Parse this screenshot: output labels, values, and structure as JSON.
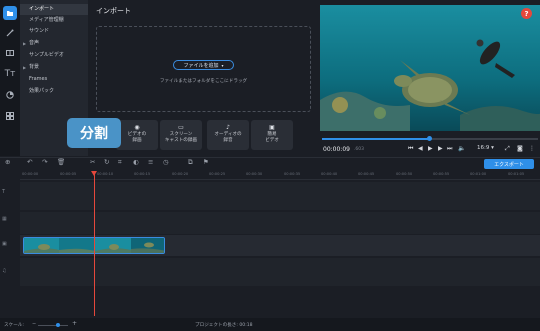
{
  "rail": {
    "icons": [
      "import-icon",
      "magic-wand-icon",
      "transitions-icon",
      "titles-icon",
      "stickers-icon",
      "more-icon"
    ],
    "titles_glyph": "Tт"
  },
  "menu": {
    "items": [
      {
        "label": "インポート",
        "selected": true,
        "arrow": false
      },
      {
        "label": "メディア管理棚",
        "selected": false,
        "arrow": false
      },
      {
        "label": "サウンド",
        "selected": false,
        "arrow": false
      },
      {
        "label": "音声",
        "selected": false,
        "arrow": true
      },
      {
        "label": "サンプルビデオ",
        "selected": false,
        "arrow": false
      },
      {
        "label": "背景",
        "selected": false,
        "arrow": true
      },
      {
        "label": "Frames",
        "selected": false,
        "arrow": false
      },
      {
        "label": "効果パック",
        "selected": false,
        "arrow": false
      }
    ]
  },
  "import": {
    "title": "インポート",
    "add_files_label": "ファイルを追加",
    "drop_hint": "ファイルまたはフォルダをここにドラッグ",
    "buttons": [
      {
        "line1": "ビデオの",
        "line2": "録画",
        "icon": "webcam-icon"
      },
      {
        "line1": "スクリーン",
        "line2": "キャストの録画",
        "icon": "screen-icon"
      },
      {
        "line1": "オーディオの",
        "line2": "録音",
        "icon": "mic-icon"
      },
      {
        "line1": "簡易",
        "line2": "ビデオ",
        "icon": "gift-icon"
      }
    ],
    "tooltip": "分割"
  },
  "preview": {
    "help": "?",
    "timecode": "00:00:09",
    "timecode_ms": ".603",
    "progress": 0.5,
    "aspect": "16:9 ▾"
  },
  "toolbar": {
    "export_label": "エクスポート"
  },
  "timeline": {
    "ticks": [
      "00:00:00",
      "00:00:05",
      "00:00:10",
      "00:00:15",
      "00:00:20",
      "00:00:25",
      "00:00:30",
      "00:00:35",
      "00:00:40",
      "00:00:45",
      "00:00:50",
      "00:00:55",
      "00:01:00",
      "00:01:05"
    ]
  },
  "bottom": {
    "scale_label": "スケール:",
    "project_length": "プロジェクトの長さ: 00:18"
  },
  "colors": {
    "accent": "#2f8fe8",
    "playhead": "#e5483c",
    "tooltip": "#4a93c7"
  }
}
